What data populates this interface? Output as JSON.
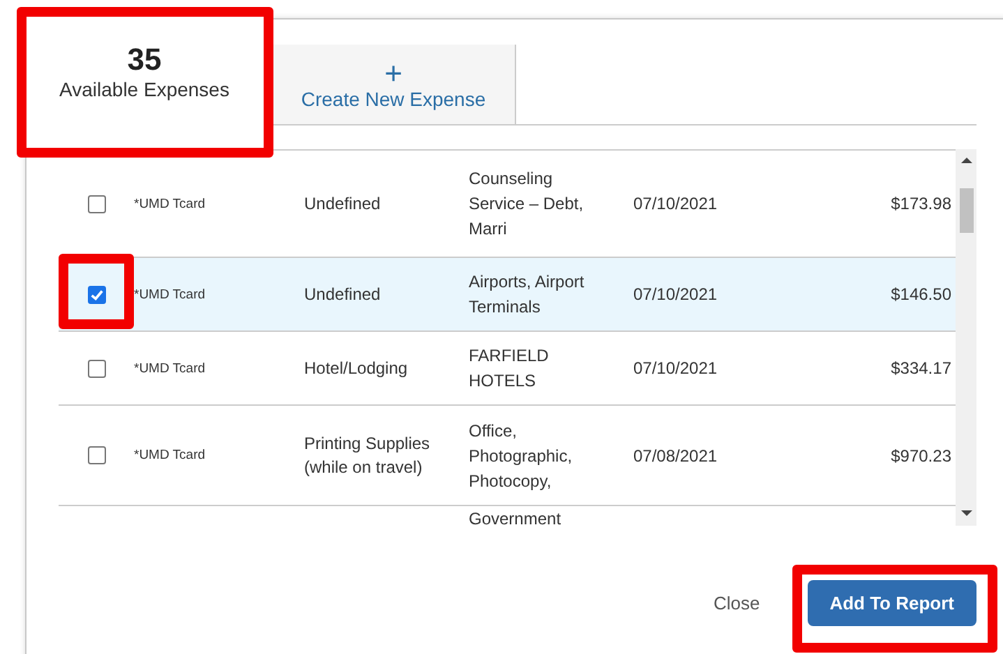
{
  "tabs": [
    {
      "count": "35",
      "label": "Available Expenses",
      "selected": true,
      "highlighted": true
    },
    {
      "icon": "+",
      "label": "Create New Expense",
      "selected": false,
      "highlighted": false
    }
  ],
  "table": {
    "rows": [
      {
        "checked": false,
        "highlighted": false,
        "card": "*UMD Tcard",
        "type": "Undefined",
        "vendor": "Counseling Service – Debt, Marri",
        "date": "07/10/2021",
        "amount": "$173.98"
      },
      {
        "checked": true,
        "highlighted": true,
        "card": "*UMD Tcard",
        "type": "Undefined",
        "vendor": "Airports, Airport Terminals",
        "date": "07/10/2021",
        "amount": "$146.50"
      },
      {
        "checked": false,
        "highlighted": false,
        "card": "*UMD Tcard",
        "type": "Hotel/Lodging",
        "vendor": "FARFIELD HOTELS",
        "date": "07/10/2021",
        "amount": "$334.17"
      },
      {
        "checked": false,
        "highlighted": false,
        "card": "*UMD Tcard",
        "type": "Printing Supplies (while on travel)",
        "vendor": "Office, Photographic, Photocopy,",
        "date": "07/08/2021",
        "amount": "$970.23"
      }
    ],
    "partial_row": {
      "vendor": "Government"
    }
  },
  "buttons": [
    {
      "kind": "link",
      "label": "Close",
      "highlighted": false
    },
    {
      "kind": "primary",
      "label": "Add To Report",
      "highlighted": true
    }
  ]
}
